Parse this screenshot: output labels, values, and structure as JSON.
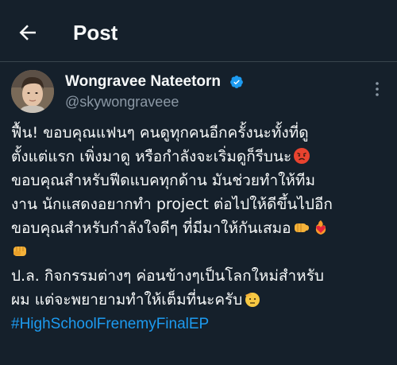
{
  "header": {
    "title": "Post",
    "back_icon": "arrow-left-icon"
  },
  "author": {
    "name": "Wongravee Nateetorn",
    "handle": "@skywongraveee",
    "verified_icon": "verified-badge-icon",
    "verified_color": "#1d9bf0"
  },
  "tweet": {
    "line1": "ฟื้น! ขอบคุณแฟนๆ คนดูทุกคนอีกครั้งนะทั้งที่ดู",
    "line2": "ตั้งแต่แรก เพิ่งมาดู หรือกำลังจะเริ่มดูก็รีบนะ",
    "line3": "ขอบคุณสำหรับฟีดแบคทุกด้าน มันช่วยทำให้ทีม",
    "line4": "งาน นักแสดงอยากทำ project ต่อไปให้ดีขึ้นไปอีก",
    "line5": "ขอบคุณสำหรับกำลังใจดีๆ ที่มีมาให้กันเสมอ",
    "line7": "ป.ล. กิจกรรมต่างๆ ค่อนข้างๆเป็นโลกใหม่สำหรับ",
    "line8": "ผม แต่จะพยายามทำให้เต็มที่นะครับ",
    "hashtag": "#HighSchoolFrenemyFinalEP",
    "emojis": [
      "angry-face-icon",
      "right-fist-icon",
      "heart-on-fire-icon",
      "oncoming-fist-icon",
      "saluting-face-icon"
    ]
  },
  "colors": {
    "background": "#15202b",
    "text": "#f7f9f9",
    "secondary_text": "#8b98a5",
    "link": "#1d9bf0",
    "divider": "#38444d"
  }
}
